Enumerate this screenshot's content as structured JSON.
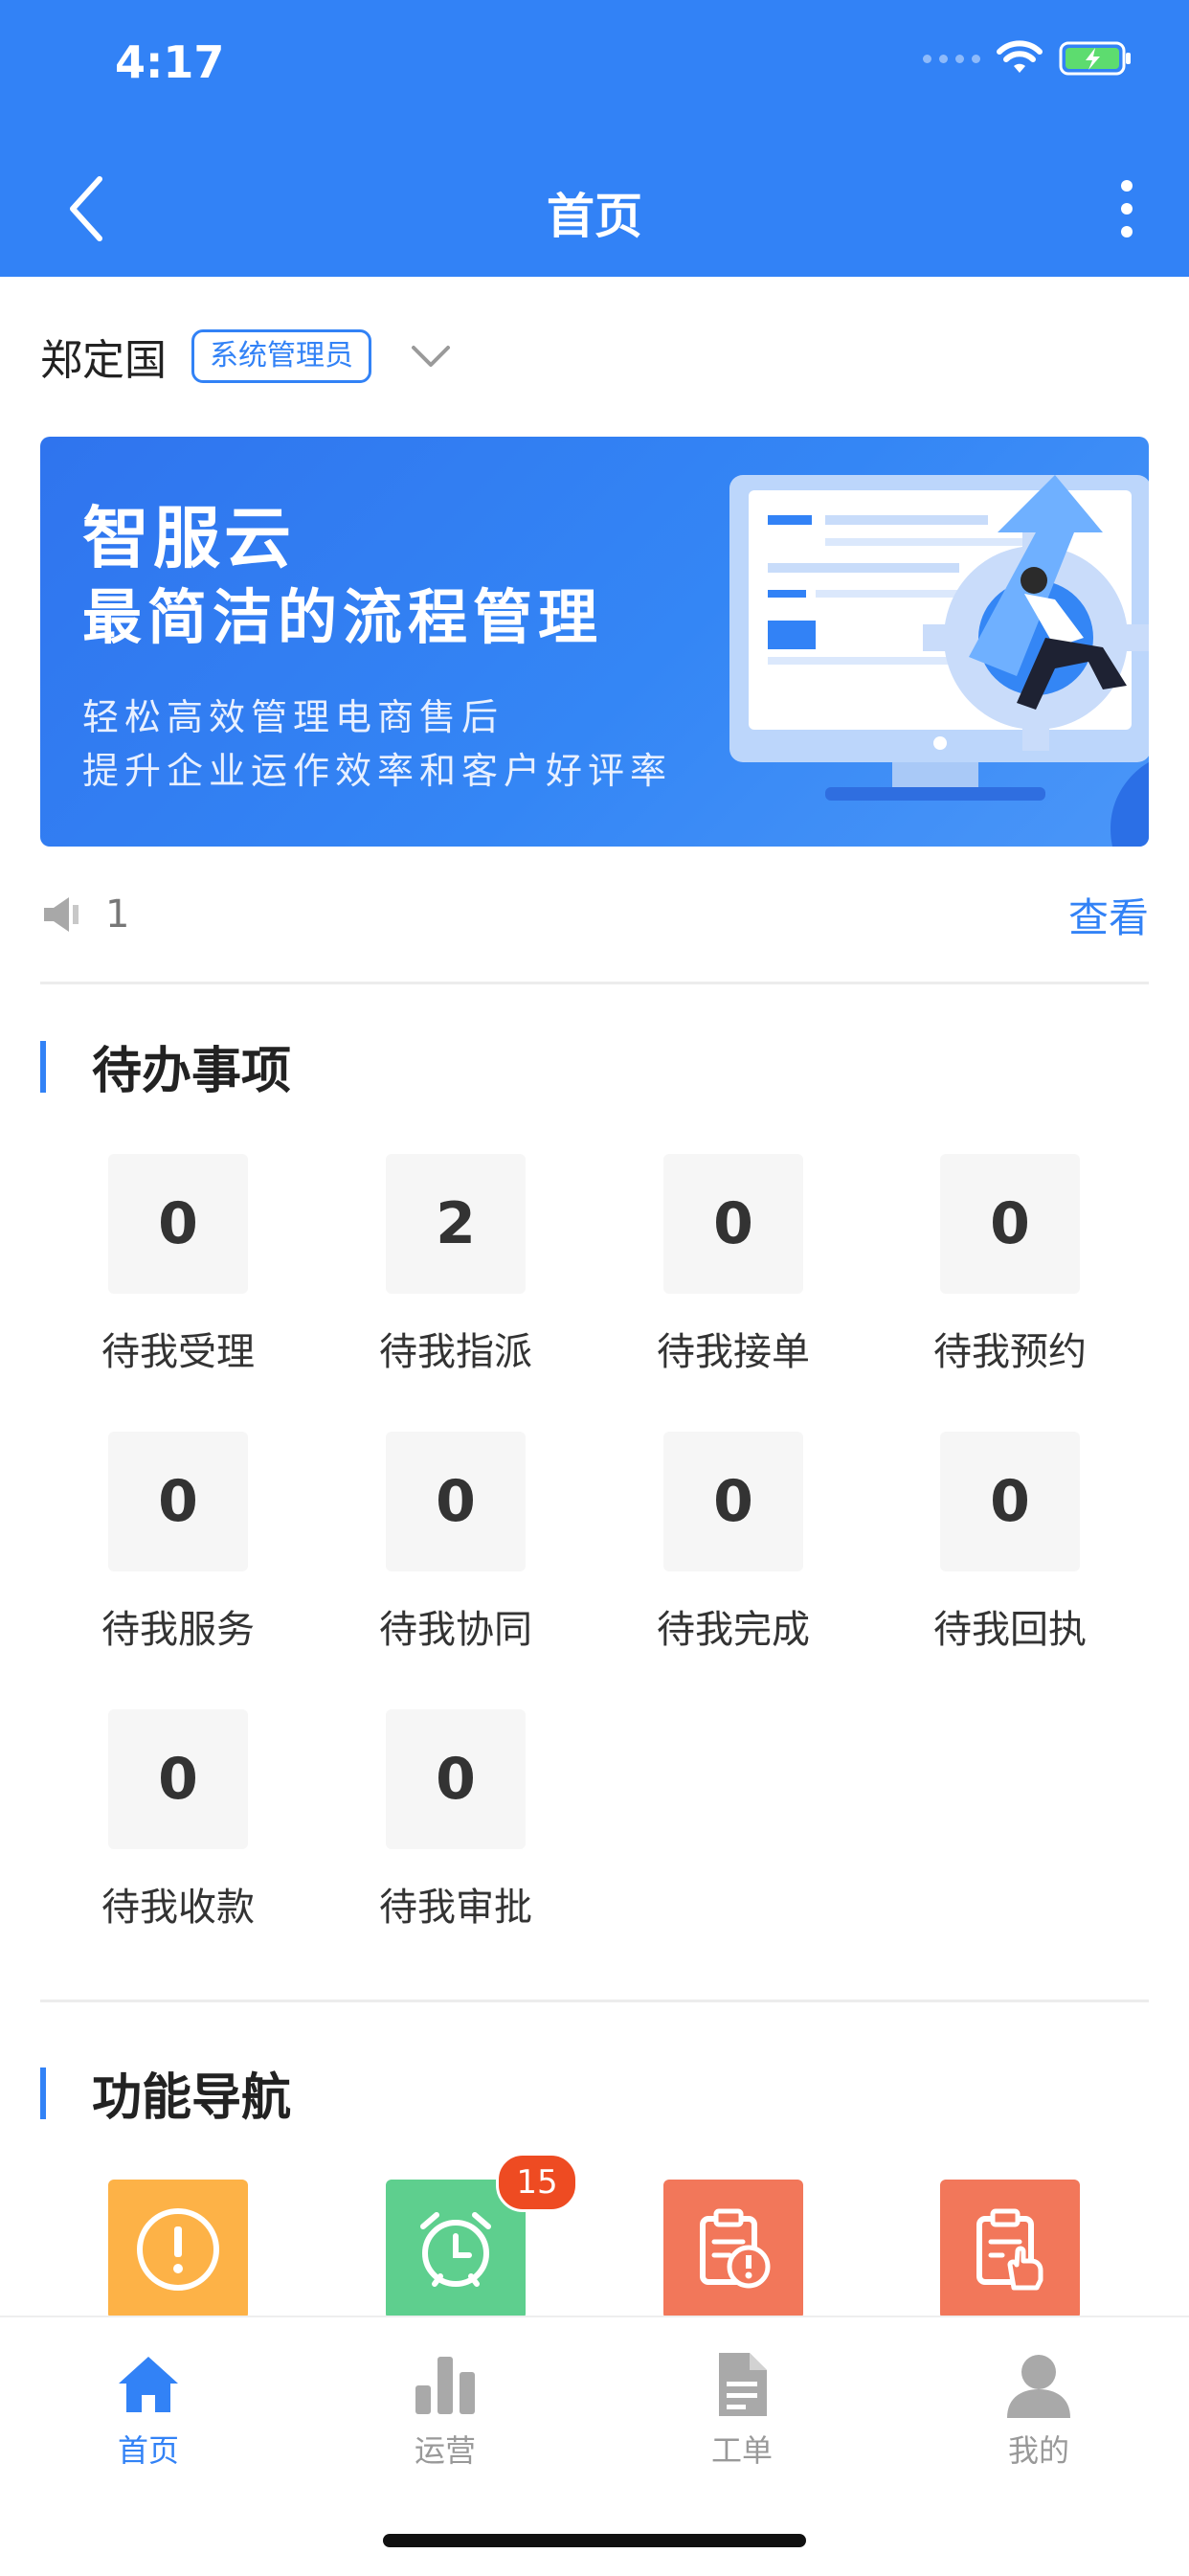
{
  "status_bar": {
    "time": "4:17"
  },
  "header": {
    "title": "首页"
  },
  "user": {
    "name": "郑定国",
    "role": "系统管理员"
  },
  "banner": {
    "title": "智服云",
    "subtitle": "最简洁的流程管理",
    "line1": "轻松高效管理电商售后",
    "line2": "提升企业运作效率和客户好评率"
  },
  "notice": {
    "count": "1",
    "view_label": "查看"
  },
  "todo": {
    "title": "待办事项",
    "items": [
      {
        "value": "0",
        "label": "待我受理"
      },
      {
        "value": "2",
        "label": "待我指派"
      },
      {
        "value": "0",
        "label": "待我接单"
      },
      {
        "value": "0",
        "label": "待我预约"
      },
      {
        "value": "0",
        "label": "待我服务"
      },
      {
        "value": "0",
        "label": "待我协同"
      },
      {
        "value": "0",
        "label": "待我完成"
      },
      {
        "value": "0",
        "label": "待我回执"
      },
      {
        "value": "0",
        "label": "待我收款"
      },
      {
        "value": "0",
        "label": "待我审批"
      }
    ]
  },
  "functions": {
    "title": "功能导航",
    "items": [
      {
        "icon": "exclamation-icon",
        "color": "#fdb247"
      },
      {
        "icon": "alarm-clock-icon",
        "color": "#5ecf8e",
        "badge": "15"
      },
      {
        "icon": "clipboard-warning-icon",
        "color": "#f2775a"
      },
      {
        "icon": "clipboard-hand-icon",
        "color": "#f2775a"
      }
    ]
  },
  "tabbar": {
    "items": [
      {
        "label": "首页",
        "icon": "home-icon",
        "active": true
      },
      {
        "label": "运营",
        "icon": "bar-chart-icon"
      },
      {
        "label": "工单",
        "icon": "document-icon"
      },
      {
        "label": "我的",
        "icon": "person-icon"
      }
    ]
  },
  "colors": {
    "primary": "#3282f6",
    "badge": "#ee4b22"
  }
}
